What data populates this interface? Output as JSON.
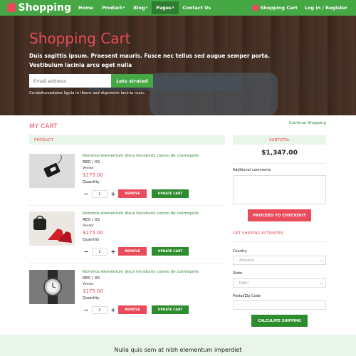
{
  "nav": {
    "brand": "Shopping",
    "items": [
      {
        "label": "Home"
      },
      {
        "label": "Product"
      },
      {
        "label": "Blog"
      },
      {
        "label": "Pages"
      },
      {
        "label": "Contact Us"
      }
    ],
    "cart_label": "Shopping Cart",
    "login_label": "Log in / Register"
  },
  "hero": {
    "title": "Shopping Cart",
    "lead": "Duis sagittis ipsum. Praesent mauris. Fusce nec tellus sed augue semper porta. Vestibulum lacinia arcu eget nulla",
    "email_placeholder": "Email address",
    "button": "Lets strated",
    "small": "Curabitursodales ligula in libero sed dignissim lacinia nunc."
  },
  "cart": {
    "heading": "MY CART",
    "continue": "Continue Shopping",
    "product_header": "PRODUCT",
    "items": [
      {
        "title": "Nominos elementum disus tincidunts cosmo de cosmopolis",
        "variant": "RED / XS",
        "vendor": "Vendor",
        "price": "$175.00",
        "qty_label": "Quantity",
        "qty": "1",
        "remove": "REMOVE",
        "update": "UPDATE CART"
      },
      {
        "title": "Nominos elementum disus tincidunts cosmo de cosmopolis",
        "variant": "RED / XS",
        "vendor": "Vendor",
        "price": "$175.00",
        "qty_label": "Quantity",
        "qty": "1",
        "remove": "REMOVE",
        "update": "UPDATE CART"
      },
      {
        "title": "Nominos elementum disus tincidunts cosmo de cosmopolis",
        "variant": "RED / XS",
        "vendor": "Vendor",
        "price": "$175.00",
        "qty_label": "Quantity",
        "qty": "1",
        "remove": "REMOVE",
        "update": "UPDATE CART"
      }
    ]
  },
  "summary": {
    "subtotal_header": "SUBTOTAL",
    "subtotal": "$1,347.00",
    "comments_label": "Additional comments",
    "checkout": "PROCEED TO CHECKOUT",
    "shipping_title": "GET SHIPPING ESTIMATES",
    "country_label": "Country",
    "country_value": "America",
    "state_label": "State",
    "state_value": "Delhi",
    "zip_label": "Postal/Zip Code",
    "calculate": "CALCULATE SHIPPING"
  },
  "footer": {
    "text": "Nulla quis sem at nibh elementum imperdiet"
  }
}
